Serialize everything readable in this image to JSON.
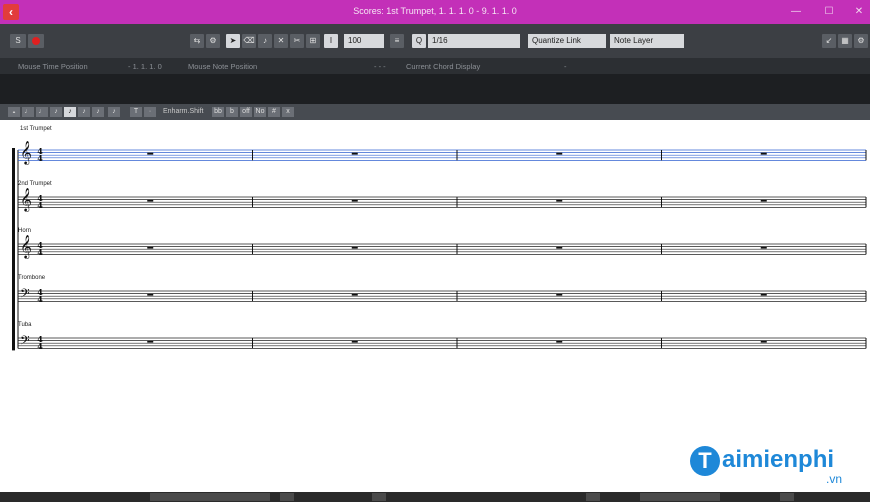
{
  "window": {
    "title": "Scores: 1st Trumpet, 1. 1. 1. 0 - 9. 1. 1. 0",
    "app_icon": "back-arrow-icon",
    "controls": [
      "minimize-icon",
      "maximize-icon",
      "close-icon"
    ],
    "accent_color": "#c330b8"
  },
  "toolbar": {
    "zoom_value": "100",
    "quantize_label": "Q",
    "quantize_value": "1/16",
    "quantize_link_label": "Quantize Link",
    "note_layer_label": "Note Layer"
  },
  "infoline": {
    "mouse_time_label": "Mouse Time Position",
    "mouse_time_value": "- 1. 1. 1. 0",
    "mouse_note_label": "Mouse Note Position",
    "mouse_note_value": "- - -",
    "chord_label": "Current Chord Display",
    "chord_value": "-"
  },
  "note_toolbar": {
    "enharmonic_label": "Enharm.Shift",
    "enharm_buttons": [
      "bb",
      "b",
      "off",
      "No",
      "#",
      "x"
    ]
  },
  "score": {
    "instruments": [
      "1st Trumpet",
      "2nd Trumpet",
      "Horn",
      "Trombone",
      "Tuba"
    ],
    "clefs": [
      "treble",
      "treble",
      "treble",
      "bass",
      "bass"
    ],
    "time_signature": {
      "top": "4",
      "bottom": "4"
    },
    "measures": 4,
    "selected_staff": 0,
    "selected_color": "#3060d0"
  },
  "watermark": {
    "brand_letter": "T",
    "brand_text": "aimienphi",
    "suffix": ".vn"
  }
}
